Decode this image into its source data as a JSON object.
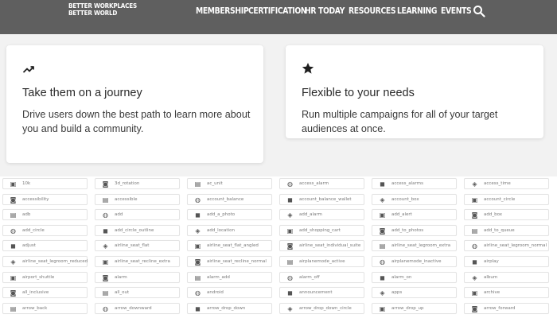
{
  "header": {
    "logo_line1": "BETTER WORKPLACES",
    "logo_line2": "BETTER WORLD",
    "nav": [
      {
        "label": "MEMBERSHIP"
      },
      {
        "label": "CERTIFICATION"
      },
      {
        "label": "HR TODAY"
      },
      {
        "label": "RESOURCES"
      },
      {
        "label": "LEARNING"
      },
      {
        "label": "EVENTS"
      }
    ],
    "search_icon": "search-icon"
  },
  "cards": [
    {
      "icon": "trending-up-icon",
      "title": "Take them on a journey",
      "text": "Drive users down the best path to learn more about you and build a community."
    },
    {
      "icon": "star-icon",
      "title": "Flexible to your needs",
      "text": "Run multiple campaigns for all of your target audiences at once."
    }
  ],
  "icon_grid": [
    [
      "10k",
      "3d_rotation",
      "ac_unit",
      "access_alarm",
      "access_alarms",
      "access_time"
    ],
    [
      "accessibility",
      "accessible",
      "account_balance",
      "account_balance_wallet",
      "account_box",
      "account_circle"
    ],
    [
      "adb",
      "add",
      "add_a_photo",
      "add_alarm",
      "add_alert",
      "add_box"
    ],
    [
      "add_circle",
      "add_circle_outline",
      "add_location",
      "add_shopping_cart",
      "add_to_photos",
      "add_to_queue"
    ],
    [
      "adjust",
      "airline_seat_flat",
      "airline_seat_flat_angled",
      "airline_seat_individual_suite",
      "airline_seat_legroom_extra",
      "airline_seat_legroom_normal"
    ],
    [
      "airline_seat_legroom_reduced",
      "airline_seat_recline_extra",
      "airline_seat_recline_normal",
      "airplanemode_active",
      "airplanemode_inactive",
      "airplay"
    ],
    [
      "airport_shuttle",
      "alarm",
      "alarm_add",
      "alarm_off",
      "alarm_on",
      "album"
    ],
    [
      "all_inclusive",
      "all_out",
      "android",
      "announcement",
      "apps",
      "archive"
    ],
    [
      "arrow_back",
      "arrow_downward",
      "arrow_drop_down",
      "arrow_drop_down_circle",
      "arrow_drop_up",
      "arrow_forward"
    ]
  ],
  "colors": {
    "nav_bg": "#5f5f5f",
    "page_bg": "#f2f2f2",
    "card_bg": "#ffffff"
  }
}
